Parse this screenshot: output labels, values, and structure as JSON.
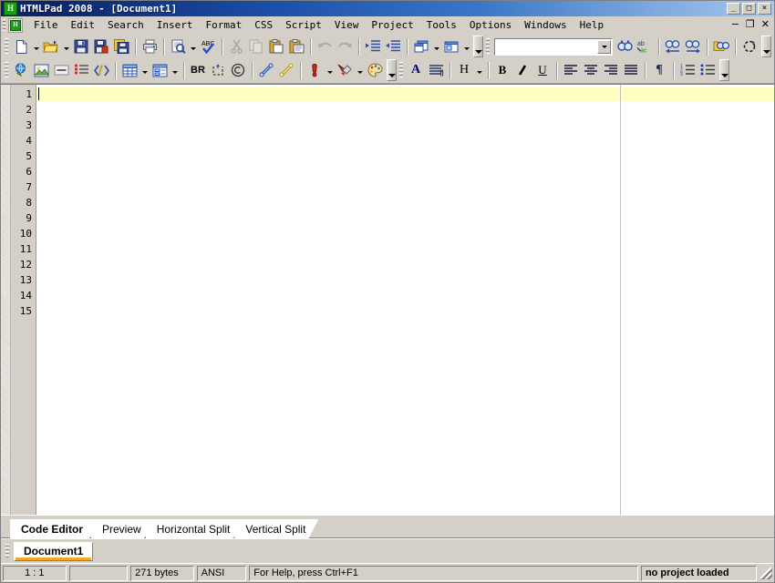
{
  "window": {
    "title": "HTMLPad 2008 - [Document1]",
    "app_icon": "H",
    "buttons": {
      "minimize": "_",
      "maximize": "□",
      "close": "×"
    },
    "mdi_buttons": {
      "minimize": "−",
      "restore": "❐",
      "close": "✕"
    }
  },
  "menu": {
    "items": [
      {
        "label": "File",
        "accel": "F"
      },
      {
        "label": "Edit",
        "accel": "E"
      },
      {
        "label": "Search",
        "accel": "S"
      },
      {
        "label": "Insert",
        "accel": "I"
      },
      {
        "label": "Format",
        "accel": "a"
      },
      {
        "label": "CSS",
        "accel": "C"
      },
      {
        "label": "Script",
        "accel": "p"
      },
      {
        "label": "View",
        "accel": "V"
      },
      {
        "label": "Project",
        "accel": "P"
      },
      {
        "label": "Tools",
        "accel": "T"
      },
      {
        "label": "Options",
        "accel": "O"
      },
      {
        "label": "Windows",
        "accel": "W"
      },
      {
        "label": "Help",
        "accel": "H"
      }
    ]
  },
  "toolbar_standard": {
    "items": [
      "new-file-icon",
      "open-folder-icon",
      "save-icon",
      "save-as-icon",
      "save-all-icon",
      "print-icon",
      "print-preview-icon",
      "spellcheck-icon",
      "cut-icon",
      "copy-icon",
      "paste-icon",
      "paste-special-icon",
      "undo-icon",
      "redo-icon",
      "indent-icon",
      "outdent-icon",
      "window-cascade-icon",
      "window-tile-icon"
    ],
    "search_combo": {
      "value": "",
      "placeholder": ""
    },
    "search_items": [
      "find-icon",
      "replace-icon",
      "find-previous-icon",
      "find-next-icon",
      "find-in-files-icon",
      "refresh-icon"
    ]
  },
  "toolbar_html": {
    "items": [
      "hyperlink-icon",
      "image-icon",
      "horizontal-rule-icon",
      "list-icon",
      "script-icon",
      "table-icon",
      "form-icon",
      "br-icon",
      "nbsp-icon",
      "copyright-icon",
      "blue-scroll-icon",
      "yellow-scroll-icon",
      "special-char-icon",
      "color-brush-icon",
      "palette-icon"
    ],
    "format_items": [
      {
        "name": "font-icon",
        "glyph": "A"
      },
      {
        "name": "paragraph-icon",
        "glyph": "≡¶"
      },
      {
        "name": "heading-icon",
        "glyph": "H"
      },
      {
        "name": "bold-icon",
        "glyph": "B"
      },
      {
        "name": "italic-icon",
        "glyph": "I"
      },
      {
        "name": "underline-icon",
        "glyph": "U"
      },
      {
        "name": "align-left-icon",
        "glyph": "≡"
      },
      {
        "name": "align-center-icon",
        "glyph": "≡"
      },
      {
        "name": "align-right-icon",
        "glyph": "≡"
      },
      {
        "name": "justify-icon",
        "glyph": "≡"
      },
      {
        "name": "pilcrow-icon",
        "glyph": "¶"
      },
      {
        "name": "ordered-list-icon",
        "glyph": "1≡"
      },
      {
        "name": "unordered-list-icon",
        "glyph": "•≡"
      }
    ]
  },
  "editor": {
    "line_numbers": [
      "1",
      "2",
      "3",
      "4",
      "5",
      "6",
      "7",
      "8",
      "9",
      "10",
      "11",
      "12",
      "13",
      "14",
      "15"
    ],
    "content": "",
    "current_line": 1,
    "margin_guide_column": 640,
    "current_line_color": "#ffffc0"
  },
  "view_tabs": [
    {
      "label": "Code Editor",
      "active": true
    },
    {
      "label": "Preview",
      "active": false
    },
    {
      "label": "Horizontal Split",
      "active": false
    },
    {
      "label": "Vertical Split",
      "active": false
    }
  ],
  "document_tabs": [
    {
      "label": "Document1",
      "active": true,
      "indicator_color": "#f5a623"
    }
  ],
  "statusbar": {
    "cursor_position": "1 : 1",
    "secondary": "",
    "file_size": "271 bytes",
    "encoding": "ANSI",
    "hint": "For Help, press Ctrl+F1",
    "project": "no project loaded"
  },
  "colors": {
    "title_gradient_start": "#0a246a",
    "title_gradient_end": "#a6c8ec",
    "chrome": "#d4d0c8",
    "editor_bg": "#ffffff",
    "current_line": "#ffffc0",
    "active_doc_indicator": "#f5a623"
  }
}
